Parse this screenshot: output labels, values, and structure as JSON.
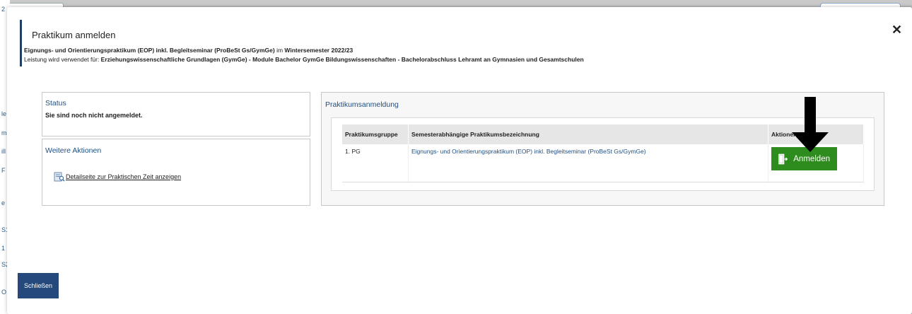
{
  "background": {
    "left_fragments": [
      "2",
      "le",
      "m",
      "ill",
      "F",
      "e",
      "S1",
      "1",
      "S2",
      "O"
    ]
  },
  "modal": {
    "title": "Praktikum anmelden",
    "info_line1": {
      "course": "Eignungs- und Orientierungspraktikum (EOP) inkl. Begleitseminar (ProBeSt Gs/GymGe)",
      "connector": " im ",
      "semester": "Wintersemester 2022/23"
    },
    "info_line2": {
      "prefix": "Leistung wird verwendet für: ",
      "value": "Erziehungswissenschaftliche Grundlagen (GymGe) - Module Bachelor GymGe Bildungswissenschaften - Bachelorabschluss Lehramt an Gymnasien und Gesamtschulen"
    },
    "close_symbol": "✕",
    "close_button_label": "Schließen"
  },
  "status_panel": {
    "heading": "Status",
    "text": "Sie sind noch nicht angemeldet."
  },
  "actions_panel": {
    "heading": "Weitere Aktionen",
    "detail_link": "Detailseite zur Praktischen Zeit anzeigen",
    "icon": "document-search-icon"
  },
  "registration_panel": {
    "heading": "Praktikumsanmeldung",
    "columns": [
      "Praktikumsgruppe",
      "Semesterabhängige Praktikumsbezeichnung",
      "Aktionen"
    ],
    "rows": [
      {
        "group": "1. PG",
        "name": "Eignungs- und Orientierungspraktikum (EOP) inkl. Begleitseminar (ProBeSt Gs/GymGe)",
        "action_label": "Anmelden"
      }
    ]
  },
  "colors": {
    "accent": "#1f3f66",
    "link": "#1f4f82",
    "button_green": "#2e8b1e",
    "button_blue": "#24497a"
  }
}
